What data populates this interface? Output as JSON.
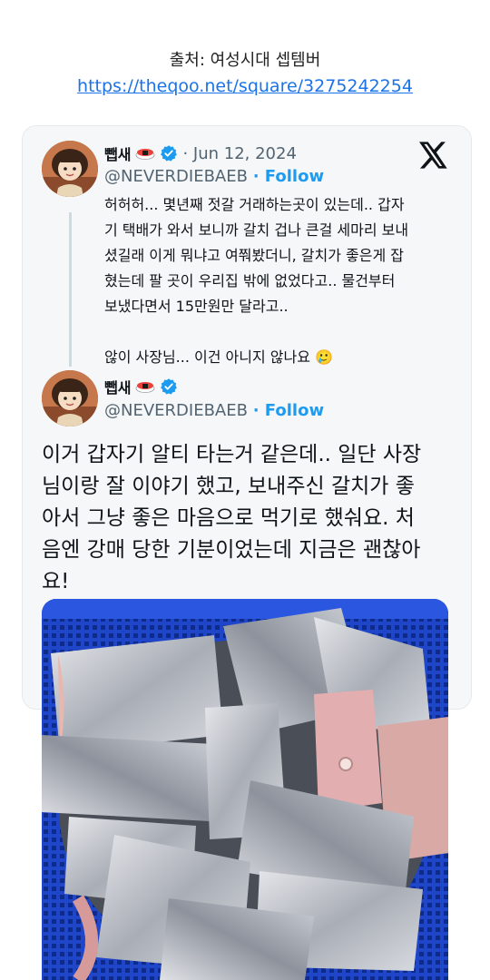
{
  "source": {
    "label": "출처: 여성시대 셉템버",
    "url": "https://theqoo.net/square/3275242254"
  },
  "tweet_main": {
    "display_name": "뺍새",
    "date": "· Jun 12, 2024",
    "handle": "@NEVERDIEBAEB",
    "follow": "· Follow",
    "text_lines": [
      "허허허... 몇년째 젓갈 거래하는곳이 있는데.. 갑자",
      "기 택배가 와서 보니까 갈치 겁나 큰걸 세마리 보내",
      "셨길래 이게 뭐냐고 여쭤봤더니, 갈치가 좋은게 잡",
      "혔는데 팔 곳이 우리집 밖에 없었다고.. 물건부터",
      "보냈다면서 15만원만 달라고.."
    ],
    "text_last": "않이 사장님... 이건 아니지 않나요",
    "emoji": "🥲"
  },
  "tweet_reply": {
    "display_name": "뺍새",
    "handle": "@NEVERDIEBAEB",
    "follow": "· Follow",
    "text_lines": [
      "이거 갑자기 알티 타는거 같은데.. 일단 사장",
      "님이랑 잘 이야기 했고, 보내주신 갈치가 좋",
      "아서 그냥 좋은 마음으로 먹기로 했숴요. 처",
      "음엔 강매 당한 기분이었는데 지금은 괜찮아",
      "요!"
    ]
  },
  "icons": {
    "verified": "verified-badge-icon",
    "x_logo": "x-logo-icon",
    "sushi_emoji": "sushi-emoji-icon"
  },
  "colors": {
    "link": "#1a73e8",
    "follow": "#1d9bf0",
    "verified": "#1d9bf0",
    "basket": "#1f45c8"
  }
}
